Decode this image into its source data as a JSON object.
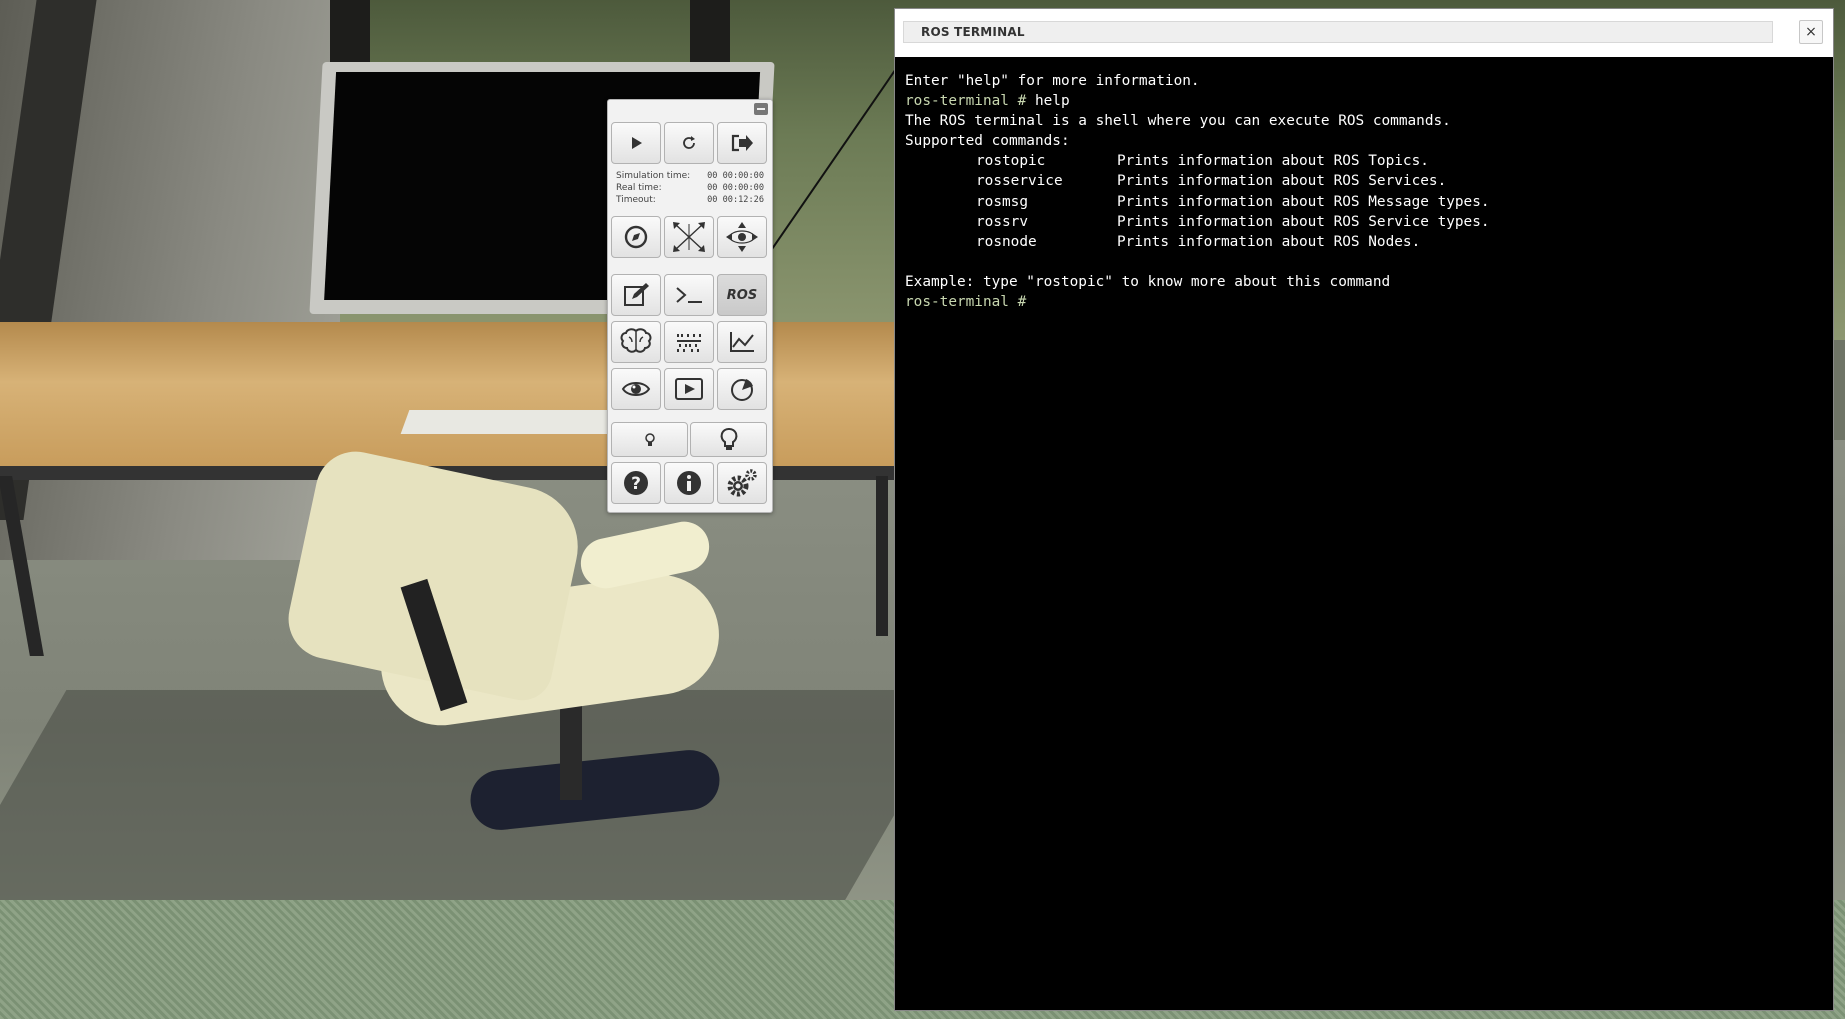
{
  "panel": {
    "minimize_icon": "minimize-icon",
    "buttons_row1": [
      "play-icon",
      "reset-icon",
      "exit-icon"
    ],
    "times": {
      "simulation_label": "Simulation time:",
      "simulation_value": "00 00:00:00",
      "real_label": "Real time:",
      "real_value": "00 00:00:00",
      "timeout_label": "Timeout:",
      "timeout_value": "00 00:12:26"
    },
    "ros_label": "ROS"
  },
  "terminal": {
    "title": "ROS TERMINAL",
    "close_label": "×",
    "intro": "Enter \"help\" for more information.",
    "prompt": "ros-terminal #",
    "typed_command": "help",
    "description": "The ROS terminal is a shell where you can execute ROS commands.",
    "supported_header": "Supported commands:",
    "commands": [
      {
        "name": "rostopic",
        "desc": "Prints information about ROS Topics."
      },
      {
        "name": "rosservice",
        "desc": "Prints information about ROS Services."
      },
      {
        "name": "rosmsg",
        "desc": "Prints information about ROS Message types."
      },
      {
        "name": "rossrv",
        "desc": "Prints information about ROS Service types."
      },
      {
        "name": "rosnode",
        "desc": "Prints information about ROS Nodes."
      }
    ],
    "example": "Example: type \"rostopic\" to know more about this command",
    "final_prompt": "ros-terminal #"
  }
}
